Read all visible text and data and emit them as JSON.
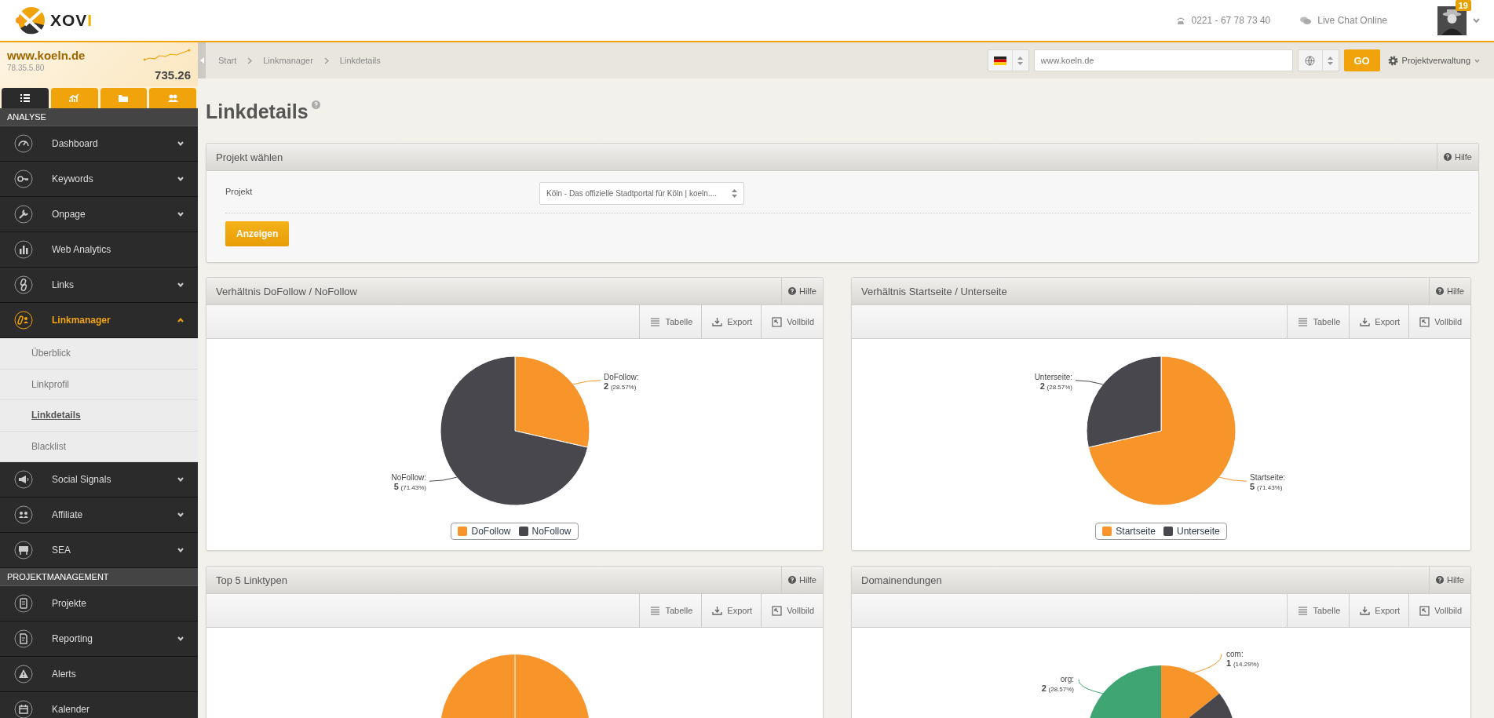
{
  "header": {
    "brand": "XOVI",
    "phone": "0221 - 67 78 73 40",
    "chat": "Live Chat Online",
    "notifications": "19"
  },
  "site": {
    "domain": "www.koeln.de",
    "ip": "78.35.5.80",
    "score": "735.26"
  },
  "sidebar": {
    "tabs": [
      {
        "selected": true
      },
      {
        "selected": false
      },
      {
        "selected": false
      },
      {
        "selected": false
      }
    ],
    "sections": [
      {
        "title": "ANALYSE",
        "items": [
          {
            "label": "Dashboard",
            "chevron": true,
            "expanded": false,
            "selected": false
          },
          {
            "label": "Keywords",
            "chevron": true,
            "expanded": false,
            "selected": false
          },
          {
            "label": "Onpage",
            "chevron": true,
            "expanded": false,
            "selected": false
          },
          {
            "label": "Web Analytics",
            "chevron": false,
            "selected": false
          },
          {
            "label": "Links",
            "chevron": true,
            "expanded": false,
            "selected": false
          },
          {
            "label": "Linkmanager",
            "chevron": true,
            "expanded": true,
            "selected": true,
            "children": [
              {
                "label": "Überblick",
                "selected": false
              },
              {
                "label": "Linkprofil",
                "selected": false
              },
              {
                "label": "Linkdetails",
                "selected": true
              },
              {
                "label": "Blacklist",
                "selected": false
              }
            ]
          },
          {
            "label": "Social Signals",
            "chevron": true,
            "expanded": false,
            "selected": false
          },
          {
            "label": "Affiliate",
            "chevron": true,
            "expanded": false,
            "selected": false
          },
          {
            "label": "SEA",
            "chevron": true,
            "expanded": false,
            "selected": false
          }
        ]
      },
      {
        "title": "PROJEKTMANAGEMENT",
        "items": [
          {
            "label": "Projekte",
            "chevron": false,
            "selected": false
          },
          {
            "label": "Reporting",
            "chevron": true,
            "expanded": false,
            "selected": false
          },
          {
            "label": "Alerts",
            "chevron": false,
            "selected": false
          },
          {
            "label": "Kalender",
            "chevron": false,
            "selected": false
          }
        ]
      }
    ]
  },
  "breadcrumb": [
    "Start",
    "Linkmanager",
    "Linkdetails"
  ],
  "toolbar": {
    "url": "www.koeln.de",
    "go": "GO",
    "project_menu": "Projektverwaltung"
  },
  "page_title": "Linkdetails",
  "project_panel": {
    "title": "Projekt wählen",
    "help": "Hilfe",
    "label": "Projekt",
    "value": "Köln - Das offizielle Stadtportal für Köln | koeln....",
    "button": "Anzeigen"
  },
  "chart_panels": [
    {
      "title": "Verhältnis DoFollow / NoFollow",
      "help": "Hilfe",
      "tools": [
        "Tabelle",
        "Export",
        "Vollbild"
      ],
      "slices": [
        {
          "name": "DoFollow:",
          "count": "2",
          "percent": "(28.57%)",
          "color": "#f7952a"
        },
        {
          "name": "NoFollow:",
          "count": "5",
          "percent": "(71.43%)",
          "color": "#48474d"
        }
      ],
      "chart_data": {
        "type": "pie",
        "categories": [
          "DoFollow",
          "NoFollow"
        ],
        "values": [
          2,
          5
        ],
        "data_labels": true,
        "legend": "bottom"
      }
    },
    {
      "title": "Verhältnis Startseite / Unterseite",
      "help": "Hilfe",
      "tools": [
        "Tabelle",
        "Export",
        "Vollbild"
      ],
      "slices": [
        {
          "name": "Startseite:",
          "count": "5",
          "percent": "(71.43%)",
          "color": "#f7952a"
        },
        {
          "name": "Unterseite:",
          "count": "2",
          "percent": "(28.57%)",
          "color": "#48474d"
        }
      ],
      "chart_data": {
        "type": "pie",
        "categories": [
          "Startseite",
          "Unterseite"
        ],
        "values": [
          5,
          2
        ],
        "data_labels": true,
        "legend": "bottom"
      }
    },
    {
      "title": "Top 5 Linktypen",
      "help": "Hilfe",
      "tools": [
        "Tabelle",
        "Export",
        "Vollbild"
      ]
    },
    {
      "title": "Domainendungen",
      "help": "Hilfe",
      "tools": [
        "Tabelle",
        "Export",
        "Vollbild"
      ],
      "slices": [
        {
          "name": "com:",
          "count": "1",
          "percent": "(14.29%)",
          "color": "#f7952a"
        },
        {
          "name": "org:",
          "count": "2",
          "percent": "(28.57%)",
          "color": "#3fa573"
        }
      ]
    }
  ]
}
